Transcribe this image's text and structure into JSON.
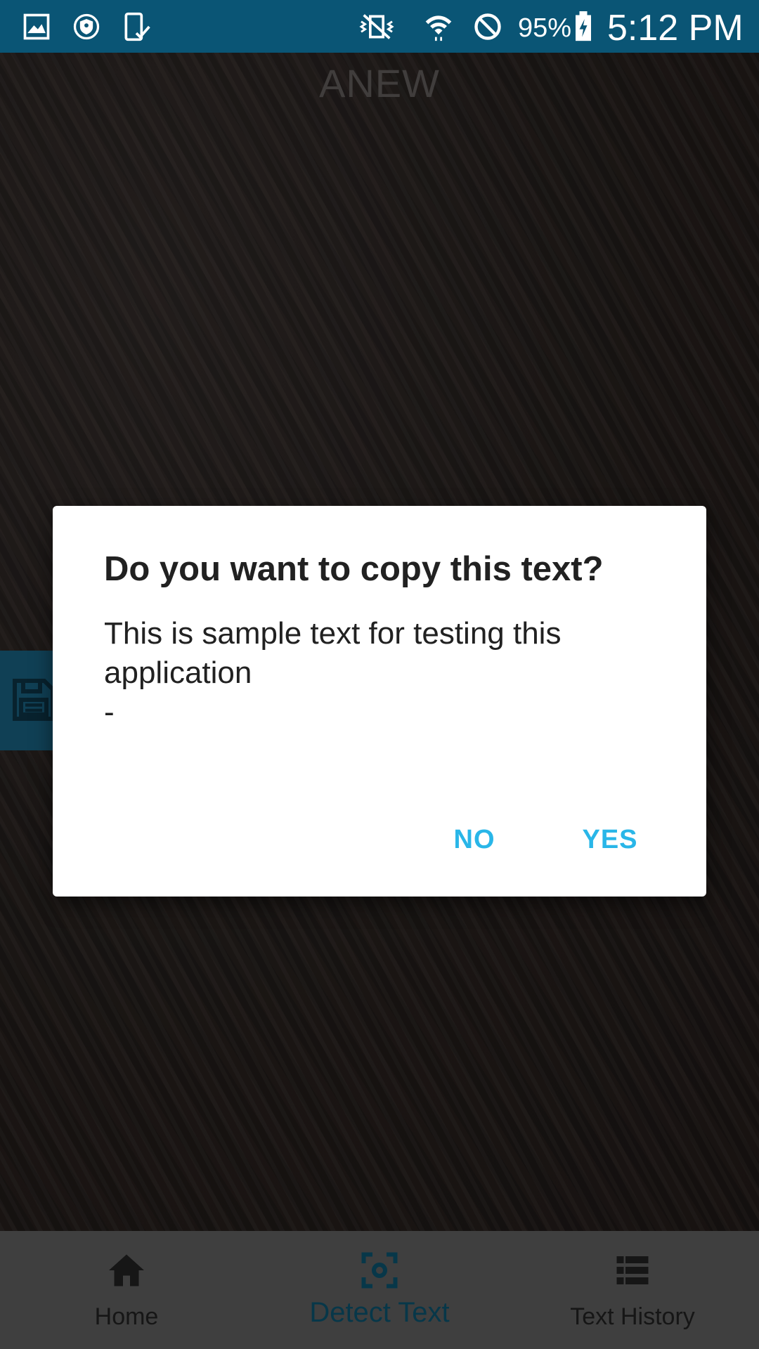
{
  "status_bar": {
    "battery_percent": "95%",
    "time": "5:12 PM",
    "icons": [
      "gallery-icon",
      "vpn-shield-icon",
      "phone-check-icon",
      "vibrate-icon",
      "wifi-icon",
      "do-not-disturb-icon",
      "battery-charging-icon"
    ]
  },
  "app": {
    "title": "ANEW"
  },
  "dialog": {
    "title": "Do you want to copy this text?",
    "message": "This is sample text for testing this application\n-",
    "no_label": "NO",
    "yes_label": "YES"
  },
  "bottom_nav": {
    "items": [
      {
        "label": "Home",
        "icon": "home-icon",
        "active": false
      },
      {
        "label": "Detect Text",
        "icon": "scan-focus-icon",
        "active": true
      },
      {
        "label": "Text History",
        "icon": "list-icon",
        "active": false
      }
    ]
  },
  "colors": {
    "status_bar": "#0a5575",
    "accent": "#29b6e8",
    "nav_active": "#0d5f7e",
    "nav_background": "#6d6d6d"
  }
}
